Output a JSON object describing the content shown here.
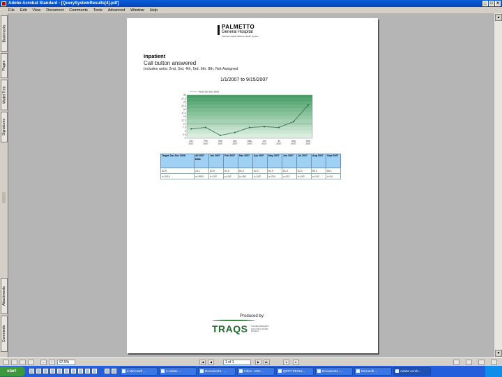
{
  "window": {
    "title": "Adobe Acrobat Standard - [QuerySystemResults[4].pdf]",
    "buttons": [
      "_",
      "□",
      "×"
    ]
  },
  "menu": [
    "File",
    "Edit",
    "View",
    "Document",
    "Comments",
    "Tools",
    "Advanced",
    "Window",
    "Help"
  ],
  "nav_tabs": [
    "Bookmarks",
    "Pages",
    "Model Tree",
    "Signatures",
    "Attachments",
    "Comments"
  ],
  "document": {
    "logo": {
      "name": "PALMETTO",
      "sub": "General Hospital",
      "tag": "Palmetto Health Alliance Health System"
    },
    "title": "Inpatient",
    "subtitle": "Call button answered",
    "units": "Includes units: 2nd, 3rd, 4th, 5rd, 6th, 8th, Not Assigned",
    "date_range": "1/1/2007 to 9/15/2007",
    "table": {
      "headers": [
        "Target Jan-Dec 2006",
        "All 2007 Data",
        "Jan 2007",
        "Feb 2007",
        "Mar 2007",
        "Apr 2007",
        "May 2007",
        "Jun 2007",
        "Jul 2007",
        "Aug 2007",
        "Sept 2007"
      ],
      "rows": [
        [
          "82.5",
          "24.1",
          "82.5",
          "81.6",
          "81.6",
          "82.2",
          "81.9",
          "81.9",
          "82.2",
          "85.0",
          "85.1"
        ],
        [
          "n=2414",
          "n=1853",
          "n=192",
          "n=162",
          "n=180",
          "n=192",
          "n=224",
          "n=212",
          "n=192",
          "n=192",
          "n=34"
        ]
      ]
    },
    "produced_by": "Produced by:",
    "traqs": {
      "name": "TRAQS",
      "tagline": "Trending Research Associates Quality Systems"
    }
  },
  "chart_data": {
    "type": "line",
    "legend": [
      "Trend Jan-Dec 2006"
    ],
    "categories": [
      "Jan 2007",
      "Feb 2007",
      "Mar 2007",
      "Apr 2007",
      "May 2007",
      "Jun 2007",
      "Jul 2007",
      "Aug 2007",
      "Sept 2007"
    ],
    "series": [
      {
        "values": [
          6.5,
          7.5,
          2.0,
          4.0,
          7.5,
          8.0,
          7.5,
          11.5,
          23.0
        ]
      }
    ],
    "yticks": [
      "0",
      "2.5",
      "5",
      "7.5",
      "10",
      "12.5",
      "15",
      "17.5",
      "20",
      "22.5",
      "25",
      "27.5",
      "30"
    ],
    "ylim": [
      0,
      30
    ],
    "target": 10,
    "colors": {
      "line": "#2a6b46",
      "target": "#e07a2d",
      "fill_top": "#3f9a5e",
      "fill_bottom": "#e3f2e6"
    }
  },
  "statusbar": {
    "zoom": "97.5%",
    "page": "1 of 1"
  },
  "taskbar": {
    "start": "start",
    "tasks": [
      "2 Microsoft ...",
      "2 Adobe ...",
      "Document3 - ...",
      "Inbox - Micr...",
      "QRPT RESUL...",
      "Document4 -...",
      "Microsoft ...",
      "Adobe Acrob..."
    ]
  }
}
